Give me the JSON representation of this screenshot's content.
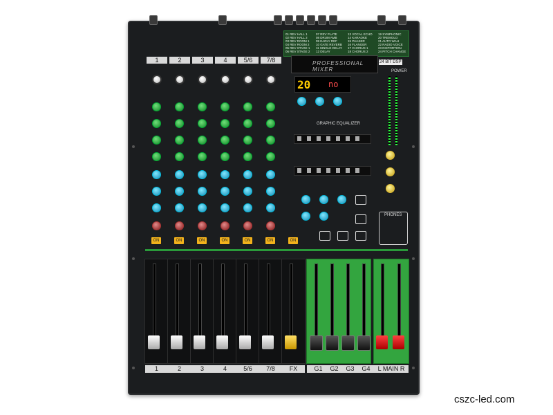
{
  "watermark": "cszc-led.com",
  "mixer": {
    "channel_labels": [
      "1",
      "2",
      "3",
      "4",
      "5/6",
      "7/8"
    ],
    "on_button_label": "ON",
    "display": {
      "preset": "20",
      "mode": "no"
    },
    "screen_title": "PROFESSIONAL MIXER",
    "eq_title": "GRAPHIC EQUALIZER",
    "fader_labels": [
      "1",
      "2",
      "3",
      "4",
      "5/6",
      "7/8",
      "FX",
      "G1",
      "G2",
      "G3",
      "G4",
      "L  MAIN  R"
    ],
    "effects": [
      "01 REV HALL 1",
      "02 REV HALL 2",
      "03 REV ROOM 1",
      "04 REV ROOM 2",
      "05 REV STAGE 1",
      "06 REV STAGE 2",
      "07 REV PLATE",
      "08 DRUM AMB",
      "09 EARLY REF",
      "10 GATE REVERB",
      "11 SINGLE DELAY",
      "12 DELAY",
      "13 VOCAL ECHO",
      "14 KARAOKE",
      "15 PHASER",
      "16 FLANGER",
      "17 CHORUS 1",
      "18 CHORUS 2",
      "19 SYMPHONIC",
      "20 TREMOLO",
      "21 AUTO WAH",
      "22 RADIO VOICE",
      "23 DISTORTION",
      "24 PITCH CHANGE"
    ],
    "badges": {
      "dsp": "24 BIT DSP",
      "power": "POWER",
      "phones": "PHONES"
    },
    "colors": {
      "body": "#1b1d1f",
      "green_panel": "#33a53f",
      "on_button": "#f2b21c",
      "display_digits": "#ffcc00"
    }
  }
}
